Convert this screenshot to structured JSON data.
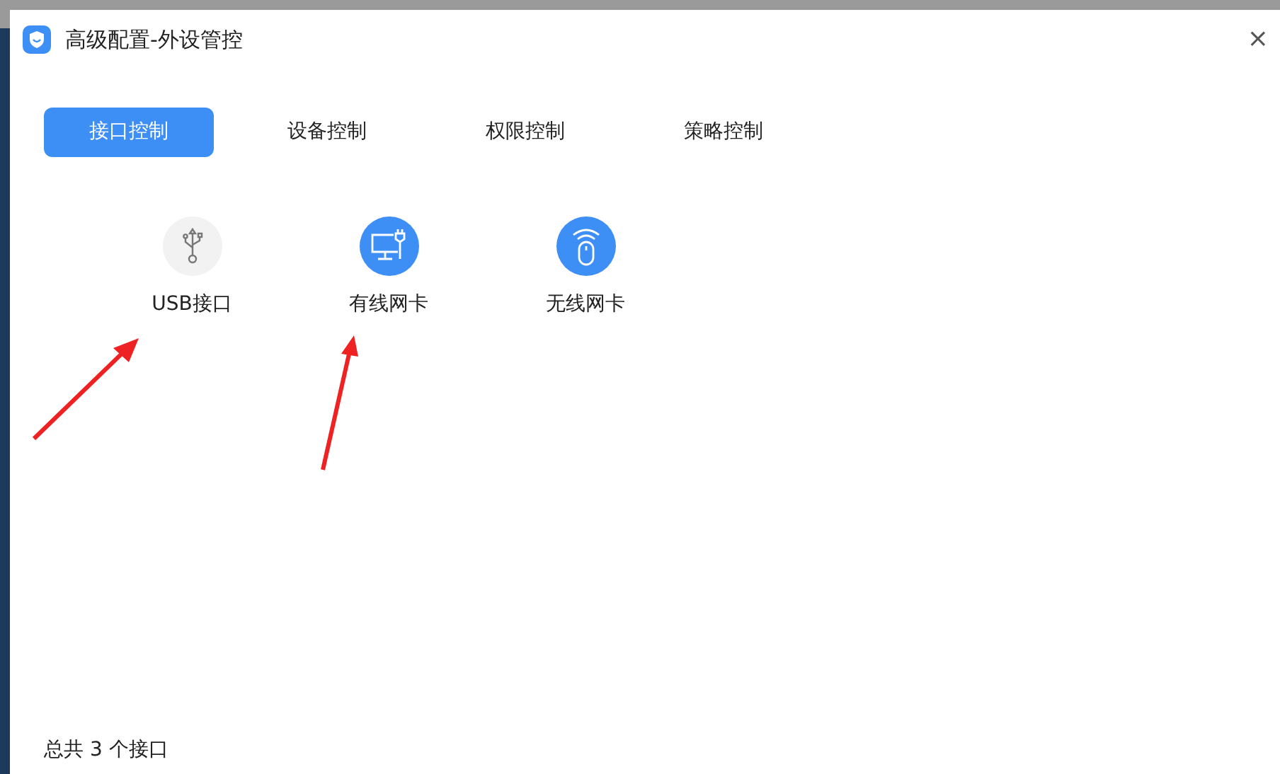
{
  "window": {
    "title": "高级配置-外设管控",
    "close": "×"
  },
  "tabs": [
    {
      "label": "接口控制",
      "selected": true
    },
    {
      "label": "设备控制",
      "selected": false
    },
    {
      "label": "权限控制",
      "selected": false
    },
    {
      "label": "策略控制",
      "selected": false
    }
  ],
  "devices": [
    {
      "kind": "usb",
      "label": "USB接口",
      "enabled": false
    },
    {
      "kind": "wired",
      "label": "有线网卡",
      "enabled": true
    },
    {
      "kind": "wireless",
      "label": "无线网卡",
      "enabled": true
    }
  ],
  "footer": "总共 3 个接口"
}
